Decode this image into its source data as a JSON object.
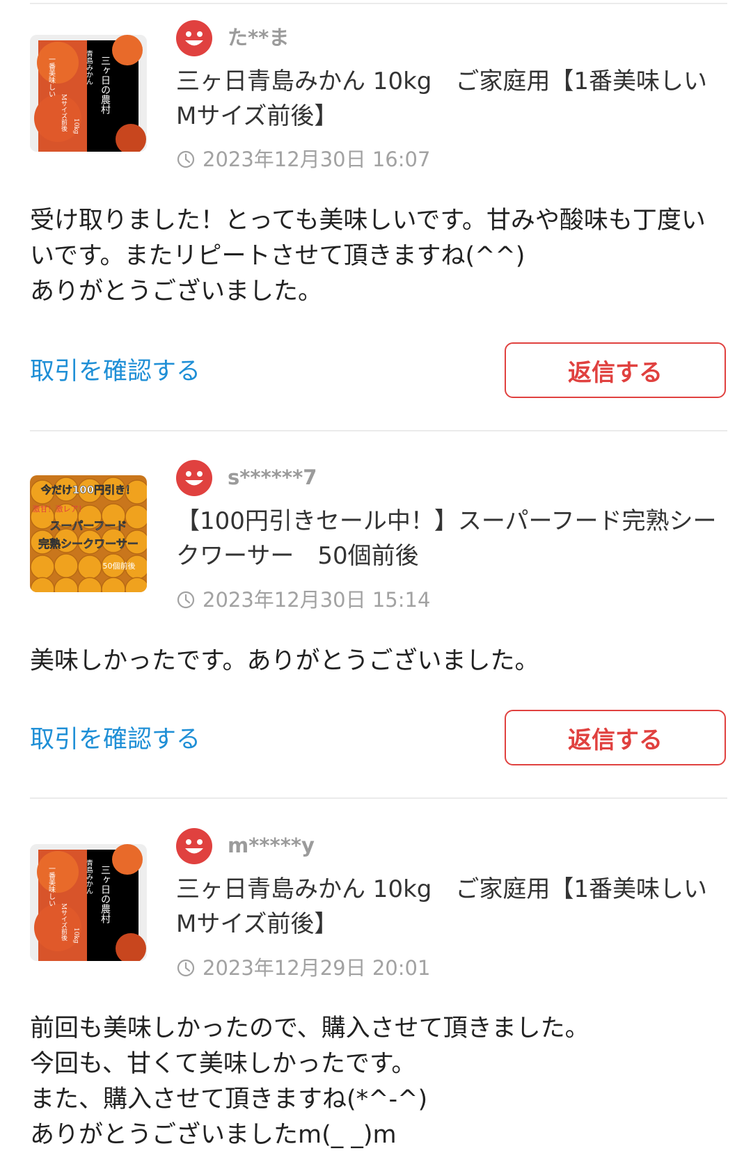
{
  "colors": {
    "accent_red": "#e0413f",
    "link_blue": "#1f8fd6",
    "muted_gray": "#9b9b9b",
    "divider": "#ebebeb"
  },
  "reviews": [
    {
      "username": "た**ま",
      "item_title": "三ヶ日青島みかん 10kg　ご家庭用【1番美味しいMサイズ前後】",
      "timestamp": "2023年12月30日 16:07",
      "comment": "受け取りました！とっても美味しいです。甘みや酸味も丁度いいです。またリピートさせて頂きますね(^^)\nありがとうございました。",
      "confirm_label": "取引を確認する",
      "reply_label": "返信する",
      "thumb_icon": "mikan-product-image"
    },
    {
      "username": "s******7",
      "item_title": "【100円引きセール中！】スーパーフード完熟シークワーサー　50個前後",
      "timestamp": "2023年12月30日 15:14",
      "comment": "美味しかったです。ありがとうございました。",
      "confirm_label": "取引を確認する",
      "reply_label": "返信する",
      "thumb_icon": "shikuwasa-product-image"
    },
    {
      "username": "m*****y",
      "item_title": "三ヶ日青島みかん 10kg　ご家庭用【1番美味しいMサイズ前後】",
      "timestamp": "2023年12月29日 20:01",
      "comment": "前回も美味しかったので、購入させて頂きました。\n今回も、甘くて美味しかったです。\nまた、購入させて頂きますね(*^-^)\nありがとうございましたm(_ _)m",
      "confirm_label": "",
      "reply_label": "",
      "thumb_icon": "mikan-product-image"
    }
  ],
  "thumbnail_texts": {
    "mikan": [
      "三ヶ日の農村",
      "青島みかん",
      "一番美味しい",
      "Mサイズ前後",
      "10kg"
    ],
    "shikuwasa": [
      "今だけ100円引き！",
      "激甘！激レア！",
      "スーパーフード",
      "完熟シークワーサー",
      "50個前後"
    ]
  }
}
